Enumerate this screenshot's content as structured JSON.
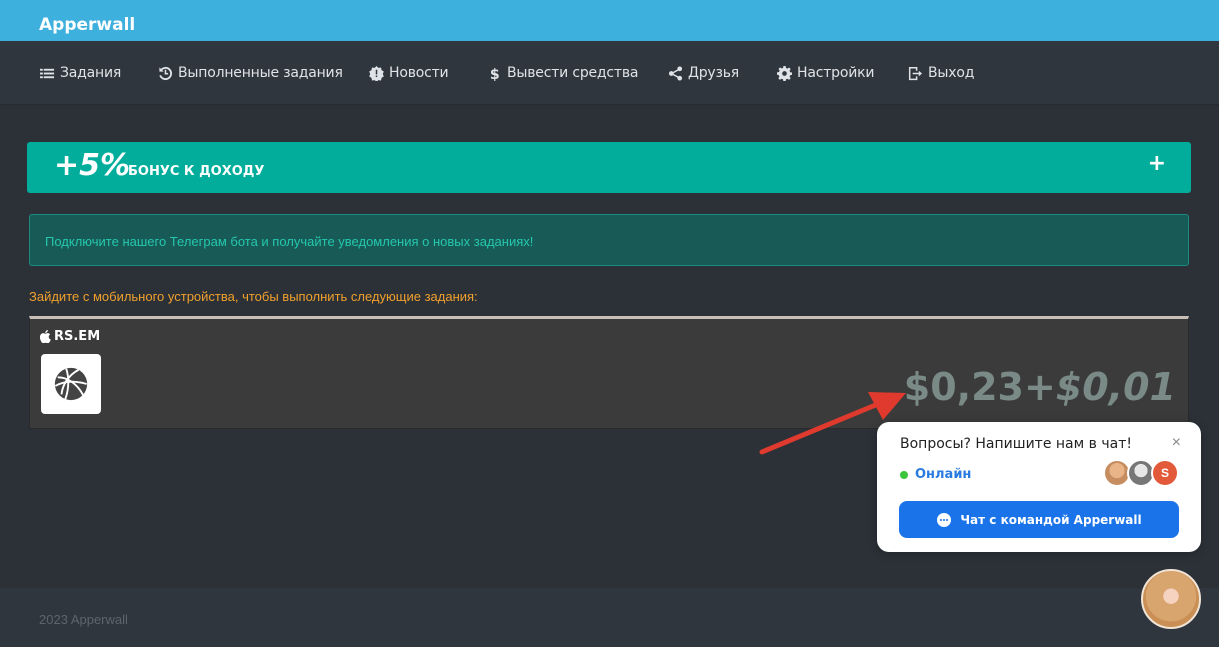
{
  "brand": "Apperwall",
  "nav": [
    {
      "label": "Задания",
      "icon": "list-icon"
    },
    {
      "label": "Выполненные задания",
      "icon": "history-icon"
    },
    {
      "label": "Новости",
      "icon": "news-badge-icon"
    },
    {
      "label": "Вывести средства",
      "icon": "dollar-icon"
    },
    {
      "label": "Друзья",
      "icon": "share-icon"
    },
    {
      "label": "Настройки",
      "icon": "gear-icon"
    },
    {
      "label": "Выход",
      "icon": "logout-icon"
    }
  ],
  "bonus": {
    "big": "+5%",
    "small": "БОНУС К ДОХОДУ",
    "plus": "+"
  },
  "telegram_notice": "Подключите нашего Телеграм бота и получайте уведомления о новых заданиях!",
  "mobile_note": "Зайдите с мобильного устройства, чтобы выполнить следующие задания:",
  "task": {
    "platform_icon": "apple-icon",
    "name": "RS.EM",
    "reward_base": "$0,23",
    "reward_bonus": "+$0,01"
  },
  "footer": "2023 Apperwall",
  "chat": {
    "title": "Вопросы? Напишите нам в чат!",
    "close": "×",
    "status": "Онлайн",
    "avatar3_letter": "S",
    "button": "Чат с командой Apperwall"
  },
  "colors": {
    "topbar": "#3db0dd",
    "bonus_bar": "#02ae9b",
    "notice_bg": "#185a55",
    "notice_text": "#25c8ae",
    "mobile_note": "#f0a02c",
    "chat_button": "#1a73e8",
    "online_dot": "#3cc43c",
    "arrow": "#e03a2e"
  }
}
